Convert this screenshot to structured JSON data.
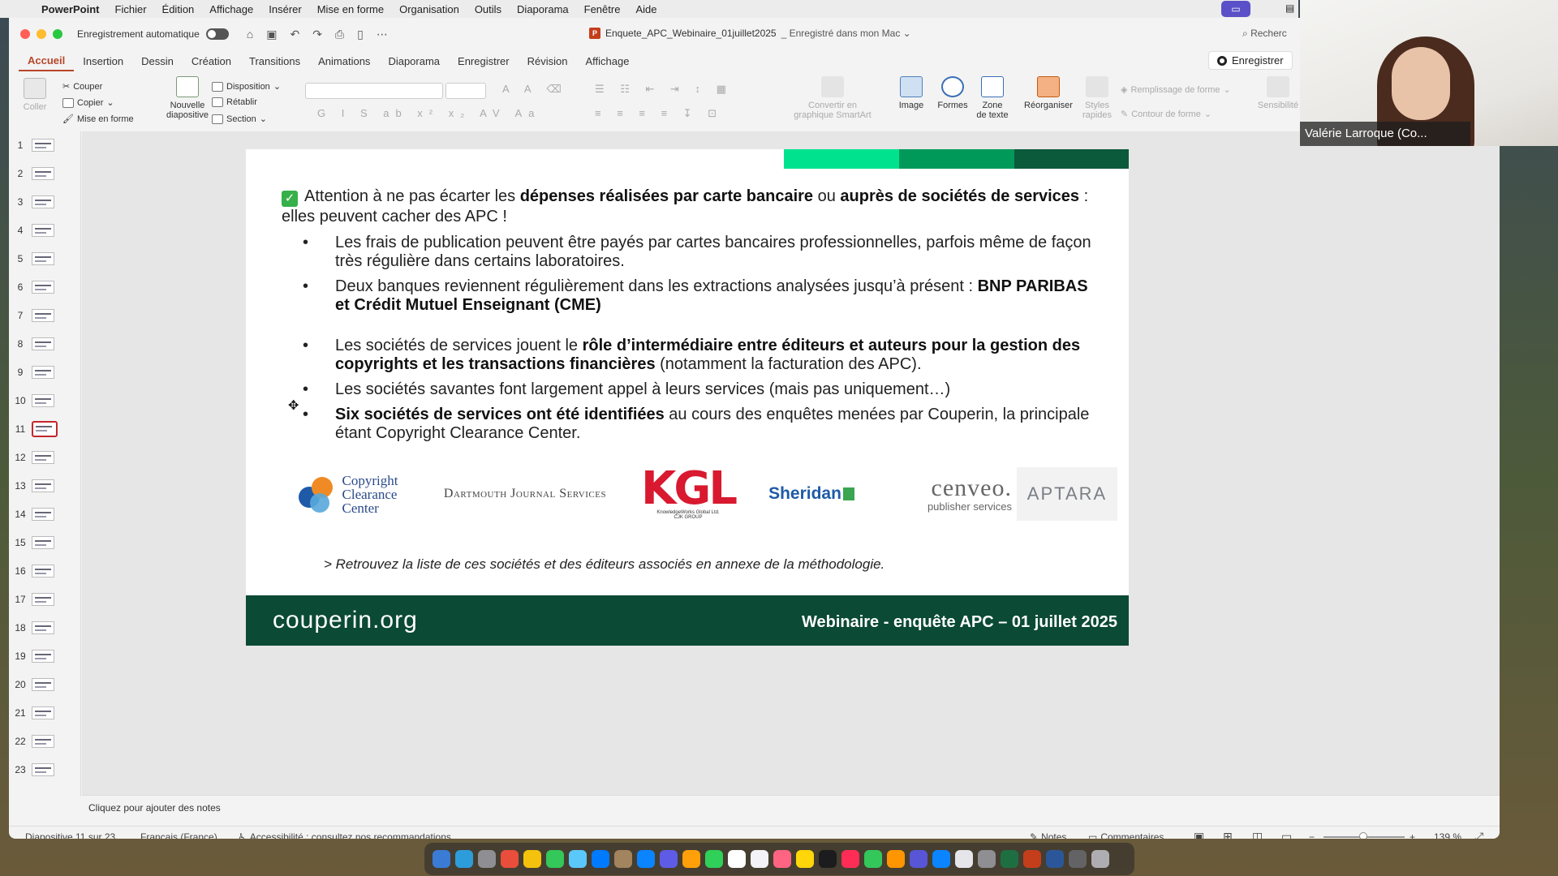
{
  "menubar": {
    "app": "PowerPoint",
    "items": [
      "Fichier",
      "Édition",
      "Affichage",
      "Insérer",
      "Mise en forme",
      "Organisation",
      "Outils",
      "Diaporama",
      "Fenêtre",
      "Aide"
    ]
  },
  "titlebar": {
    "autosave_label": "Enregistrement automatique",
    "document_title": "Enquete_APC_Webinaire_01juillet2025",
    "save_status": "_ Enregistré dans mon Mac ⌄",
    "search_label": "Recherc"
  },
  "ribbon": {
    "tabs": [
      "Accueil",
      "Insertion",
      "Dessin",
      "Création",
      "Transitions",
      "Animations",
      "Diaporama",
      "Enregistrer",
      "Révision",
      "Affichage"
    ],
    "save_button": "Enregistrer",
    "paste": "Coller",
    "cut": "Couper",
    "copy": "Copier",
    "format_painter": "Mise en forme",
    "new_slide_1": "Nouvelle",
    "new_slide_2": "diapositive",
    "layout": "Disposition",
    "reset": "Rétablir",
    "section": "Section",
    "smartart_1": "Convertir en",
    "smartart_2": "graphique SmartArt",
    "image": "Image",
    "shapes": "Formes",
    "textbox_1": "Zone",
    "textbox_2": "de texte",
    "arrange": "Réorganiser",
    "quick_styles_1": "Styles",
    "quick_styles_2": "rapides",
    "shape_fill": "Remplissage de forme",
    "shape_outline": "Contour de forme",
    "sensitivity": "Sensibilité"
  },
  "thumbnails": [
    "1",
    "2",
    "3",
    "4",
    "5",
    "6",
    "7",
    "8",
    "9",
    "10",
    "11",
    "12",
    "13",
    "14",
    "15",
    "16",
    "17",
    "18",
    "19",
    "20",
    "21",
    "22",
    "23"
  ],
  "active_slide": "11",
  "slide": {
    "intro_text_1": "Attention à ne pas écarter les ",
    "intro_bold_1": "dépenses réalisées par carte bancaire",
    "intro_text_2": " ou ",
    "intro_bold_2": "auprès de sociétés de services",
    "intro_text_3": " : elles peuvent cacher des APC !",
    "bullet1": "Les frais de publication peuvent être payés par cartes bancaires professionnelles, parfois même de façon très régulière dans certains laboratoires.",
    "bullet2_text": "Deux banques reviennent régulièrement dans les extractions analysées jusqu’à présent : ",
    "bullet2_bold": "BNP PARIBAS et Crédit Mutuel Enseignant (CME)",
    "bullet3_text_1": "Les sociétés de services jouent le ",
    "bullet3_bold": "rôle d’intermédiaire entre éditeurs et auteurs pour la gestion des copyrights et les transactions financières",
    "bullet3_text_2": " (notamment la facturation des APC).",
    "bullet4": "Les sociétés savantes font largement appel à leurs services (mais pas uniquement…)",
    "bullet5_bold": "Six sociétés de services ont été identifiées",
    "bullet5_text": " au cours des enquêtes menées par Couperin, la principale étant Copyright Clearance Center.",
    "logos": {
      "ccc_1": "Copyright",
      "ccc_2": "Clearance",
      "ccc_3": "Center",
      "dartmouth": "Dartmouth Journal Services",
      "kgl": "KGL",
      "kgl_sub": "KnowledgeWorks Global Ltd.",
      "kgl_group": "CJK GROUP",
      "sheridan": "Sheridan",
      "cenveo": "cenveo.",
      "cenveo_sub": "publisher services",
      "aptara": "APTARA"
    },
    "note_line": "> Retrouvez la liste de ces sociétés et des éditeurs associés en annexe de la méthodologie.",
    "footer_brand": "couperin.org",
    "footer_event": "Webinaire - enquête APC – 01 juillet 2025"
  },
  "notes_placeholder": "Cliquez pour ajouter des notes",
  "statusbar": {
    "slide_counter": "Diapositive 11 sur 23",
    "language": "Français (France)",
    "accessibility": "Accessibilité : consultez nos recommandations",
    "notes": "Notes",
    "comments": "Commentaires",
    "zoom": "139 %"
  },
  "webcam": {
    "participant_name": "Valérie Larroque (Co..."
  },
  "colors": {
    "accent": "#b7472a",
    "slide_footer": "#0b4a34",
    "bar_light": "#00e28e",
    "bar_mid": "#00995a",
    "bar_dark": "#0b5a3c"
  }
}
